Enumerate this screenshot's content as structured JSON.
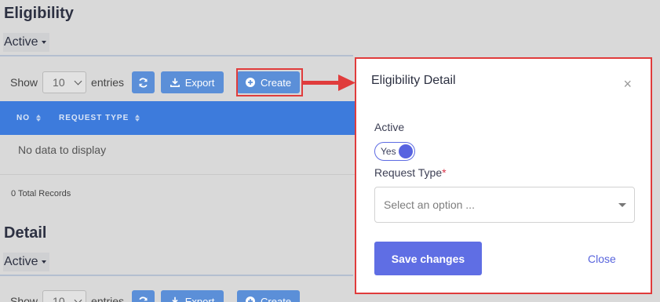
{
  "sections": [
    {
      "title": "Eligibility",
      "status": "Active"
    },
    {
      "title": "Detail",
      "status": "Active"
    }
  ],
  "toolbar": {
    "show_label": "Show",
    "entries_value": "10",
    "entries_label": "entries",
    "export_label": "Export",
    "create_label": "Create"
  },
  "table": {
    "columns": [
      "NO",
      "REQUEST TYPE"
    ],
    "empty_text": "No data to display",
    "total_records": "0 Total Records"
  },
  "modal": {
    "title": "Eligibility Detail",
    "close_glyph": "×",
    "active_label": "Active",
    "toggle_text": "Yes",
    "request_type_label": "Request Type",
    "required_mark": "*",
    "request_type_placeholder": "Select an option ...",
    "save_label": "Save changes",
    "close_label": "Close"
  },
  "colors": {
    "accent": "#5f6ee4",
    "table_header": "#3d7bdc",
    "button_blue": "#5b8fd8",
    "highlight": "#e03c3c"
  },
  "icons": [
    "refresh-icon",
    "download-icon",
    "plus-circle-icon",
    "close-icon",
    "dropdown-caret-icon"
  ]
}
